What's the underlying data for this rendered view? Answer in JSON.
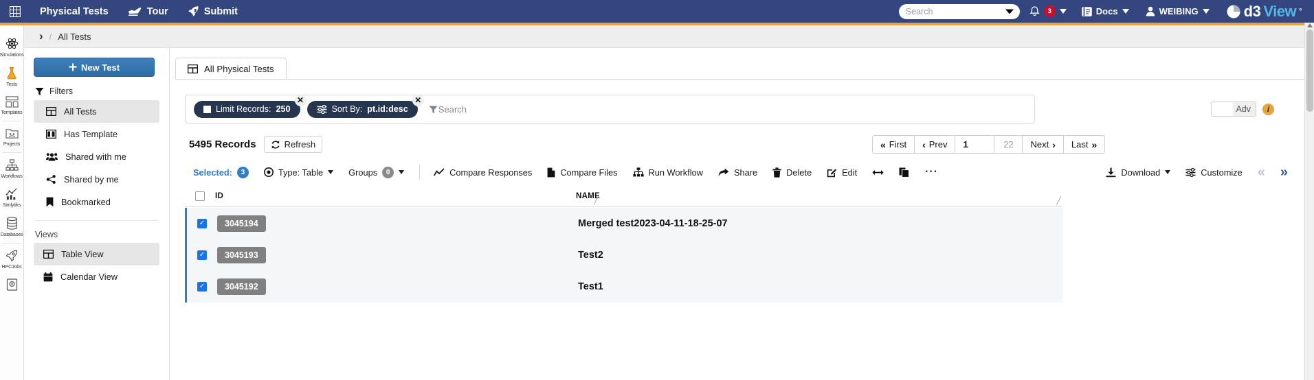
{
  "topnav": {
    "app_icon": "grid-icon",
    "app_title": "Physical Tests",
    "tour_label": "Tour",
    "submit_label": "Submit",
    "search_placeholder": "Search",
    "notification_count": "3",
    "docs_label": "Docs",
    "user_label": "WEIBING",
    "brand_d3": "d3",
    "brand_view": "View",
    "brand_star": "°",
    "bg_color": "#33477e",
    "accent_color": "#e8a33d",
    "badge_color": "#c8102e"
  },
  "breadcrumb": {
    "chevron": "›",
    "separator": "/",
    "current": "All Tests"
  },
  "rail": {
    "items": [
      {
        "icon": "atom-icon",
        "label": "Simulations",
        "active": false
      },
      {
        "icon": "flask-icon",
        "label": "Tests",
        "active": true
      },
      {
        "icon": "templates-icon",
        "label": "Templates",
        "active": false
      },
      {
        "icon": "projects-folder-icon",
        "label": "Projects",
        "active": false
      },
      {
        "icon": "workflows-icon",
        "label": "Workflows",
        "active": false
      },
      {
        "icon": "simlytiks-chart-icon",
        "label": "Simlytiks",
        "active": false
      },
      {
        "icon": "database-icon",
        "label": "Databases",
        "active": false
      },
      {
        "icon": "rocket-icon",
        "label": "HPCJobs",
        "active": false
      },
      {
        "icon": "report-icon",
        "label": "",
        "active": false
      }
    ]
  },
  "leftpanel": {
    "new_test_label": "New Test",
    "filters_label": "Filters",
    "filters": [
      {
        "icon": "table-grid-icon",
        "label": "All Tests",
        "active": true
      },
      {
        "icon": "template-columns-icon",
        "label": "Has Template",
        "active": false
      },
      {
        "icon": "users-icon",
        "label": "Shared with me",
        "active": false
      },
      {
        "icon": "share-nodes-icon",
        "label": "Shared by me",
        "active": false
      },
      {
        "icon": "bookmark-icon",
        "label": "Bookmarked",
        "active": false
      }
    ],
    "views_label": "Views",
    "views": [
      {
        "icon": "table-grid-icon",
        "label": "Table View",
        "active": true
      },
      {
        "icon": "calendar-icon",
        "label": "Calendar View",
        "active": false
      }
    ]
  },
  "main": {
    "tab": {
      "icon": "table-grid-icon",
      "label": "All Physical Tests"
    },
    "filterbar": {
      "chips": [
        {
          "icon": "checkbox-square-icon",
          "label": "Limit Records:",
          "value": "250",
          "remove": "✕"
        },
        {
          "icon": "sliders-icon",
          "label": "Sort By:",
          "value": "pt.id:desc",
          "remove": "✕"
        }
      ],
      "search_icon": "funnel-icon",
      "search_placeholder": "Search",
      "adv_label": "Adv",
      "info_icon": "info-icon",
      "info_glyph": "i"
    },
    "records": {
      "count_label": "5495 Records",
      "refresh_label": "Refresh",
      "refresh_icon": "refresh-icon"
    },
    "pager": {
      "first": "First",
      "prev": "Prev",
      "current_page": "1",
      "total_pages": "22",
      "next": "Next",
      "last": "Last"
    },
    "toolbar": {
      "selected_label": "Selected:",
      "selected_count": "3",
      "type_label": "Type: Table",
      "type_icon": "clock-icon",
      "groups_label": "Groups",
      "groups_count": "0",
      "actions": [
        {
          "icon": "chart-line-icon",
          "label": "Compare Responses"
        },
        {
          "icon": "file-icon",
          "label": "Compare Files"
        },
        {
          "icon": "sitemap-icon",
          "label": "Run Workflow"
        },
        {
          "icon": "share-arrow-icon",
          "label": "Share"
        },
        {
          "icon": "trash-icon",
          "label": "Delete"
        },
        {
          "icon": "edit-pencil-icon",
          "label": "Edit"
        },
        {
          "icon": "arrows-horizontal-icon",
          "label": ""
        },
        {
          "icon": "copy-icon",
          "label": ""
        },
        {
          "icon": "ellipsis-icon",
          "label": ""
        }
      ],
      "download_label": "Download",
      "download_icon": "download-icon",
      "customize_label": "Customize",
      "customize_icon": "sliders-icon",
      "prev_page_icon": "double-chevron-left-icon",
      "next_page_icon": "double-chevron-right-icon"
    },
    "table": {
      "columns": [
        "ID",
        "NAME"
      ],
      "rows": [
        {
          "selected": true,
          "id": "3045194",
          "name": "Merged test2023-04-11-18-25-07"
        },
        {
          "selected": true,
          "id": "3045193",
          "name": "Test2"
        },
        {
          "selected": true,
          "id": "3045192",
          "name": "Test1"
        }
      ]
    }
  }
}
